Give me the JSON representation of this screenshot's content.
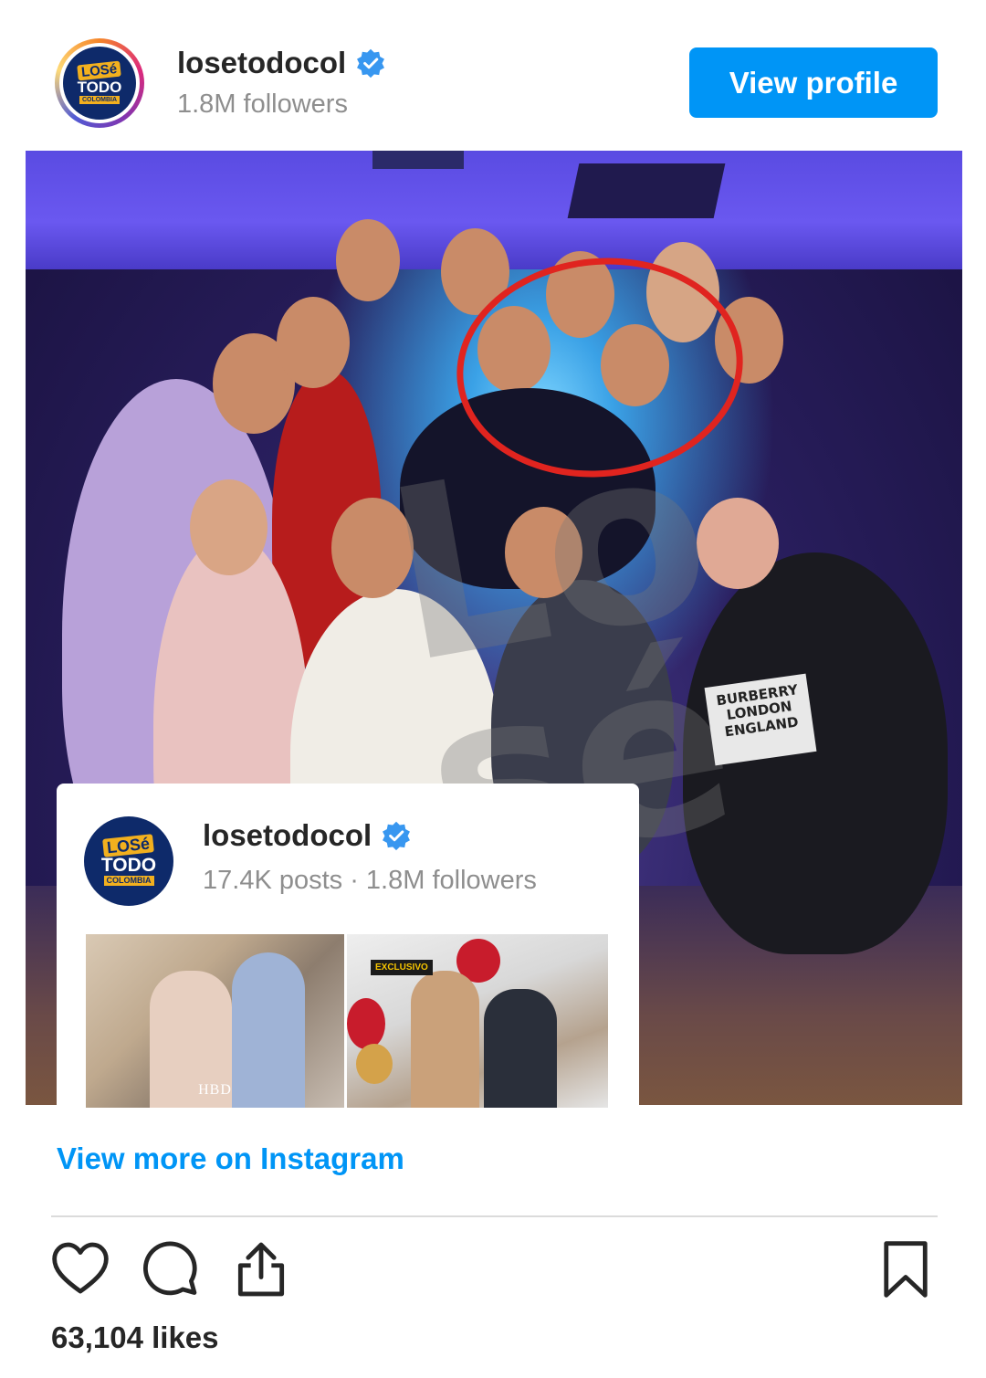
{
  "header": {
    "username": "losetodocol",
    "followers_text": "1.8M followers",
    "view_profile_label": "View profile",
    "avatar_logo": {
      "top": "LOSé",
      "mid": "TODO",
      "bottom": "COLOMBIA"
    }
  },
  "post_image": {
    "shirt_text": "BURBERRY LONDON ENGLAND",
    "watermark_text": "Lo sé"
  },
  "embed_card": {
    "username": "losetodocol",
    "stats": "17.4K posts · 1.8M followers",
    "logo": {
      "top": "LOSé",
      "mid": "TODO",
      "bottom": "COLOMBIA"
    },
    "thumb1_caption": "HBD",
    "thumb2_tag": "EXCLUSIVO"
  },
  "footer": {
    "view_more_label": "View more on Instagram",
    "likes_text": "63,104 likes"
  },
  "icons": [
    "verified-badge-icon",
    "heart-icon",
    "comment-icon",
    "share-icon",
    "bookmark-icon"
  ],
  "colors": {
    "accent": "#0095f6",
    "text": "#262626",
    "muted": "#8e8e8e",
    "highlight_circle": "#e0241f"
  }
}
